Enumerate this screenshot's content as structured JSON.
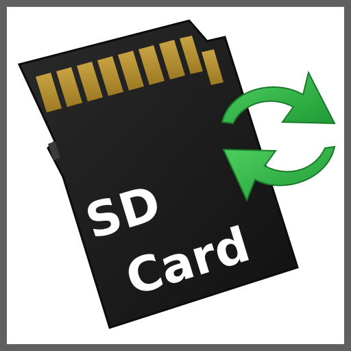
{
  "icon": {
    "line1": "SD",
    "line2": "Card",
    "colors": {
      "frame": "#606060",
      "background": "#ffffff",
      "card_body": "#1e1e1e",
      "contacts": "#b8912f",
      "arrows": "#33b54a",
      "text": "#ffffff"
    },
    "icons": [
      "sd-card-icon",
      "sync-arrows-icon"
    ]
  }
}
